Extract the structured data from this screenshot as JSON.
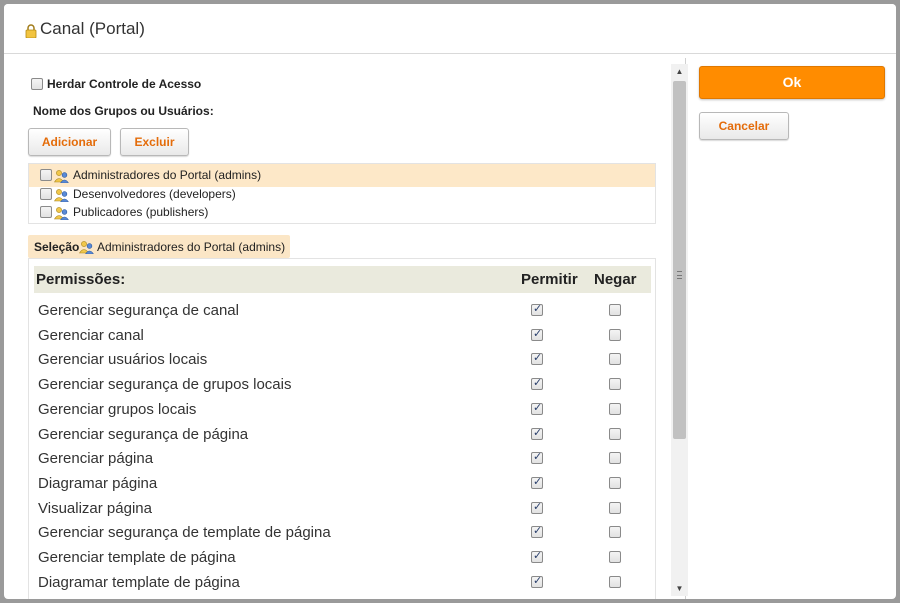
{
  "dialog": {
    "title": "Canal (Portal)",
    "title_icon": "lock-icon"
  },
  "access": {
    "inherit_label": "Herdar Controle de Acesso",
    "inherit_checked": false,
    "names_label": "Nome dos Grupos ou Usuários:",
    "add_label": "Adicionar",
    "remove_label": "Excluir"
  },
  "groups": [
    {
      "name": "Administradores do Portal (admins)",
      "selected": true,
      "checked": false,
      "icon": "group-icon"
    },
    {
      "name": "Desenvolvedores (developers)",
      "selected": false,
      "checked": false,
      "icon": "group-icon"
    },
    {
      "name": "Publicadores (publishers)",
      "selected": false,
      "checked": false,
      "icon": "group-icon"
    }
  ],
  "selection": {
    "label": "Seleção",
    "name": "Administradores do Portal (admins)"
  },
  "permissions": {
    "header_label": "Permissões:",
    "allow_label": "Permitir",
    "deny_label": "Negar",
    "rows": [
      {
        "name": "Gerenciar segurança de canal",
        "allow": true,
        "deny": false
      },
      {
        "name": "Gerenciar canal",
        "allow": true,
        "deny": false
      },
      {
        "name": "Gerenciar usuários locais",
        "allow": true,
        "deny": false
      },
      {
        "name": "Gerenciar segurança de grupos locais",
        "allow": true,
        "deny": false
      },
      {
        "name": "Gerenciar grupos locais",
        "allow": true,
        "deny": false
      },
      {
        "name": "Gerenciar segurança de página",
        "allow": true,
        "deny": false
      },
      {
        "name": "Gerenciar página",
        "allow": true,
        "deny": false
      },
      {
        "name": "Diagramar página",
        "allow": true,
        "deny": false
      },
      {
        "name": "Visualizar página",
        "allow": true,
        "deny": false
      },
      {
        "name": "Gerenciar segurança de template de página",
        "allow": true,
        "deny": false
      },
      {
        "name": "Gerenciar template de página",
        "allow": true,
        "deny": false
      },
      {
        "name": "Diagramar template de página",
        "allow": true,
        "deny": false
      }
    ]
  },
  "actions": {
    "ok_label": "Ok",
    "cancel_label": "Cancelar"
  },
  "colors": {
    "accent": "#ff8c00",
    "accent_text": "#e46c0a",
    "selected_row": "#fde8c8",
    "header_bg": "#eaeadd"
  }
}
